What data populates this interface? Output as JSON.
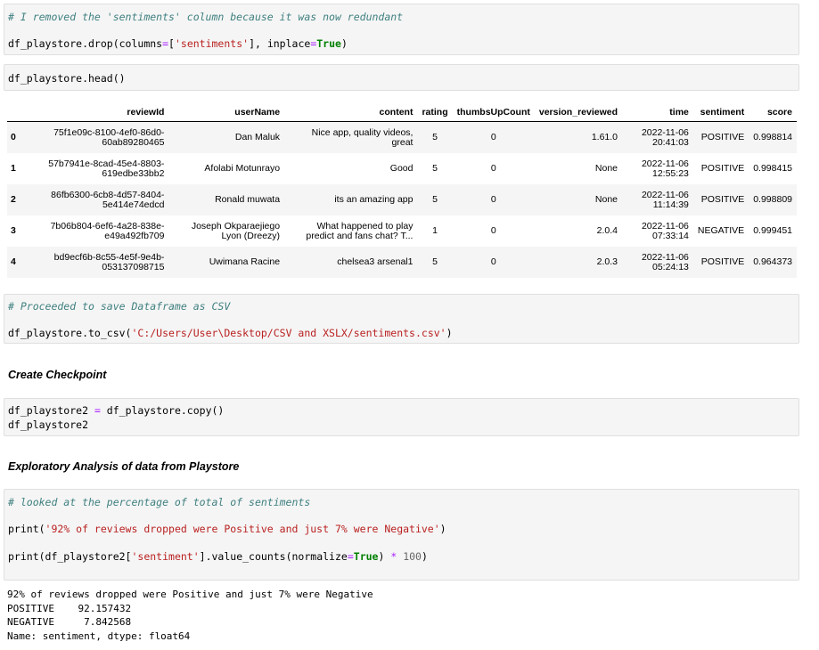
{
  "cells": {
    "drop": {
      "comment": "# I removed the 'sentiments' column because it was now redundant",
      "code_a": "df_playstore.drop(columns",
      "code_eq": "=",
      "code_b": "[",
      "code_str": "'sentiments'",
      "code_c": "], inplace",
      "code_eq2": "=",
      "code_kw": "True",
      "code_d": ")"
    },
    "head": {
      "code": "df_playstore.head()"
    },
    "save": {
      "comment": "# Proceeded to save Dataframe as CSV",
      "code_a": "df_playstore.to_csv(",
      "code_str": "'C:/Users/User\\Desktop/CSV and XSLX/sentiments.csv'",
      "code_b": ")"
    },
    "copy": {
      "line1_a": "df_playstore2 ",
      "line1_eq": "=",
      "line1_b": " df_playstore.copy()",
      "line2": "df_playstore2"
    },
    "analysis": {
      "comment": "# looked at the percentage of total of sentiments",
      "print1_a": "print(",
      "print1_str": "'92% of reviews dropped were Positive and just 7% were Negative'",
      "print1_b": ")",
      "print2_a": "print(df_playstore2[",
      "print2_str": "'sentiment'",
      "print2_b": "].value_counts(normalize",
      "print2_eq": "=",
      "print2_kw": "True",
      "print2_c": ") ",
      "print2_op": "*",
      "print2_sp": " ",
      "print2_num": "100",
      "print2_d": ")"
    }
  },
  "headings": {
    "checkpoint": "Create Checkpoint",
    "exploratory": "Exploratory Analysis of data from Playstore"
  },
  "table": {
    "columns": [
      "",
      "reviewId",
      "userName",
      "content",
      "rating",
      "thumbsUpCount",
      "version_reviewed",
      "time",
      "sentiment",
      "score"
    ],
    "rows": [
      [
        "0",
        "75f1e09c-8100-4ef0-86d0-",
        "60ab89280465",
        "Dan Maluk",
        "",
        "Nice app, quality videos,",
        "great",
        "5",
        "0",
        "1.61.0",
        "2022-11-06",
        "20:41:03",
        "POSITIVE",
        "0.998814"
      ],
      [
        "1",
        "57b7941e-8cad-45e4-8803-",
        "619edbe33bb2",
        "Afolabi Motunrayo",
        "",
        "Good",
        "",
        "5",
        "0",
        "None",
        "2022-11-06",
        "12:55:23",
        "POSITIVE",
        "0.998415"
      ],
      [
        "2",
        "86fb6300-6cb8-4d57-8404-",
        "5e414e74edcd",
        "Ronald muwata",
        "",
        "its an amazing app",
        "",
        "5",
        "0",
        "None",
        "2022-11-06",
        "11:14:39",
        "POSITIVE",
        "0.998809"
      ],
      [
        "3",
        "7b06b804-6ef6-4a28-838e-",
        "e49a492fb709",
        "Joseph Okparaejiego",
        "Lyon (Dreezy)",
        "What happened to play",
        "predict and fans chat? T...",
        "1",
        "0",
        "2.0.4",
        "2022-11-06",
        "07:33:14",
        "NEGATIVE",
        "0.999451"
      ],
      [
        "4",
        "bd9ecf6b-8c55-4e5f-9e4b-",
        "053137098715",
        "Uwimana Racine",
        "",
        "chelsea3 arsenal1",
        "",
        "5",
        "0",
        "2.0.3",
        "2022-11-06",
        "05:24:13",
        "POSITIVE",
        "0.964373"
      ]
    ]
  },
  "output": {
    "line1": "92% of reviews dropped were Positive and just 7% were Negative",
    "line2": "POSITIVE    92.157432",
    "line3": "NEGATIVE     7.842568",
    "line4": "Name: sentiment, dtype: float64"
  }
}
